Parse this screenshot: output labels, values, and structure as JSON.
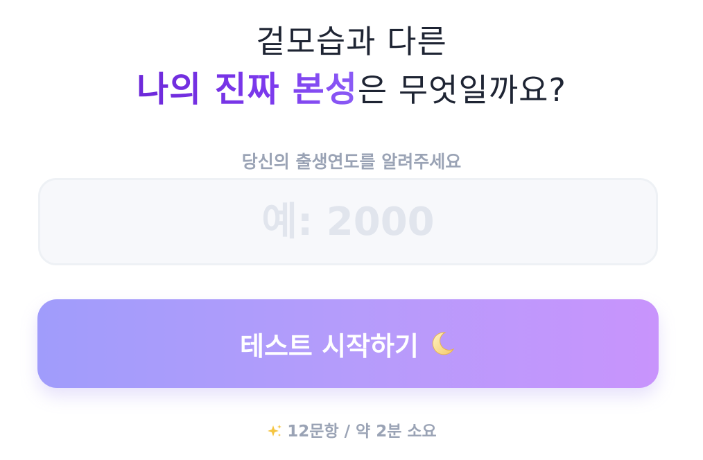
{
  "title": {
    "line1": "겉모습과 다른",
    "highlight": "나의 진짜 본성",
    "rest": "은 무엇일까요?"
  },
  "birth_year": {
    "label": "당신의 출생연도를 알려주세요",
    "value": "",
    "placeholder": "예: 2000"
  },
  "start_button": {
    "label": "테스트 시작하기",
    "icon": "crescent-moon-icon"
  },
  "footer": {
    "icon": "sparkles-icon",
    "text": "12문항 / 약 2분 소요"
  },
  "colors": {
    "highlight": "#7c3aed",
    "button_gradient_start": "#a09cfb",
    "button_gradient_end": "#c894fc",
    "label_gray": "#9aa3b5"
  }
}
